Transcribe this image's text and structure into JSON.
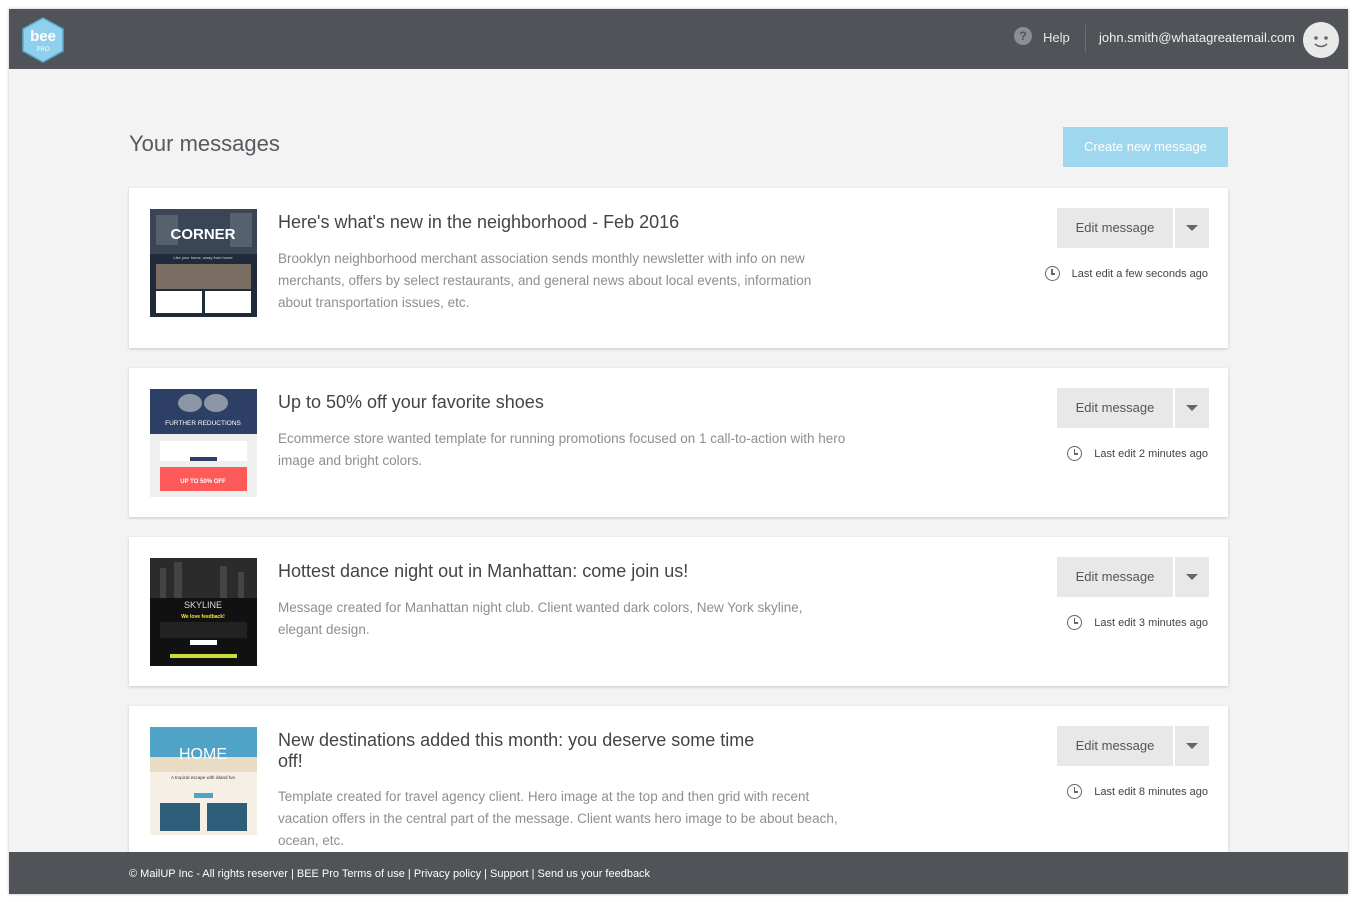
{
  "header": {
    "logo_text": "bee",
    "logo_subtext": "PRO",
    "help_label": "Help",
    "user_email": "john.smith@whatagreatemail.com"
  },
  "main": {
    "title": "Your messages",
    "create_button_label": "Create new message"
  },
  "messages": [
    {
      "title": "Here's what's new in the neighborhood - Feb 2016",
      "description": "Brooklyn neighborhood merchant association sends monthly newsletter with info on new merchants, offers by select restaurants, and general news about local events, information about transportation issues, etc.",
      "edit_label": "Edit message",
      "last_edit": "Last edit a few seconds ago",
      "thumb_title": "CORNER",
      "thumb_caption": "Like your home, away from home"
    },
    {
      "title": "Up to 50% off your favorite shoes",
      "description": "Ecommerce store wanted template for running promotions focused on 1 call-to-action with hero image and bright colors.",
      "edit_label": "Edit message",
      "last_edit": "Last edit 2 minutes ago",
      "thumb_title": "FURTHER REDUCTIONS",
      "thumb_caption": "UP TO 50% OFF"
    },
    {
      "title": "Hottest dance night out in Manhattan: come join us!",
      "description": "Message created for Manhattan night club. Client wanted dark colors, New York skyline, elegant design.",
      "edit_label": "Edit message",
      "last_edit": "Last edit 3 minutes ago",
      "thumb_title": "SKYLINE",
      "thumb_caption": "We love feedback!"
    },
    {
      "title": "New destinations added this month: you deserve some time off!",
      "description": "Template created for travel agency client. Hero image at the top and then grid with recent vacation offers in the central part of the message. Client wants hero image to be about beach, ocean, etc.",
      "edit_label": "Edit message",
      "last_edit": "Last edit 8 minutes ago",
      "thumb_title": "HOME",
      "thumb_caption": "A tropical escape with island fun"
    }
  ],
  "footer": {
    "text": "© MailUP Inc - All rights reserver | BEE Pro Terms of use | Privacy policy | Support | Send us your feedback"
  },
  "colors": {
    "topbar": "#505458",
    "accent_button": "#9fd7ee",
    "background": "#f3f3f3"
  }
}
